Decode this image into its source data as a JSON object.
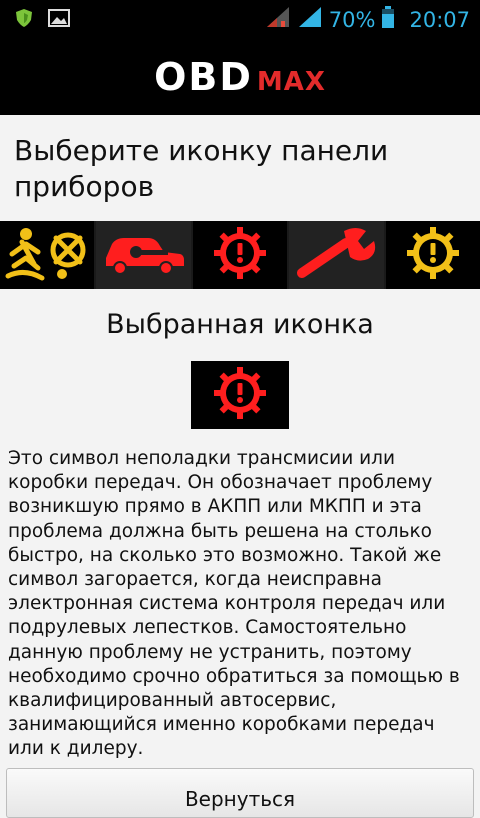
{
  "status_bar": {
    "battery_percent": "70%",
    "time": "20:07",
    "icons": [
      "shield-icon",
      "image-icon",
      "signal-icon",
      "signal-icon",
      "battery-icon"
    ]
  },
  "app": {
    "logo_part1": "OBD",
    "logo_part2": "MAX"
  },
  "heading": "Выберите иконку панели приборов",
  "icon_strip": [
    "seatbelt-airbag-icon",
    "car-key-icon",
    "gear-warning-icon",
    "wrench-icon",
    "gear-warning-icon"
  ],
  "selected": {
    "title": "Выбранная иконка",
    "icon": "gear-warning-icon",
    "description": "Это символ неполадки трансмисии или коробки передач. Он обозначает проблему возникшую прямо в АКПП или МКПП и эта проблема должна быть решена на столько быстро, на сколько это возможно. Такой же символ загорается, когда неисправна электронная система контроля передач или подрулевых лепестков. Самостоятельно данную проблему не устранить, поэтому необходимо срочно обратиться за помощью в квалифицированный автосервис, занимающийся именно коробками передач или к дилеру."
  },
  "back_button": "Вернуться",
  "colors": {
    "accent": "#33b5e5",
    "brand_red": "#e32b2b",
    "warning_yellow": "#f2c018",
    "warning_red": "#ff1e1e"
  }
}
